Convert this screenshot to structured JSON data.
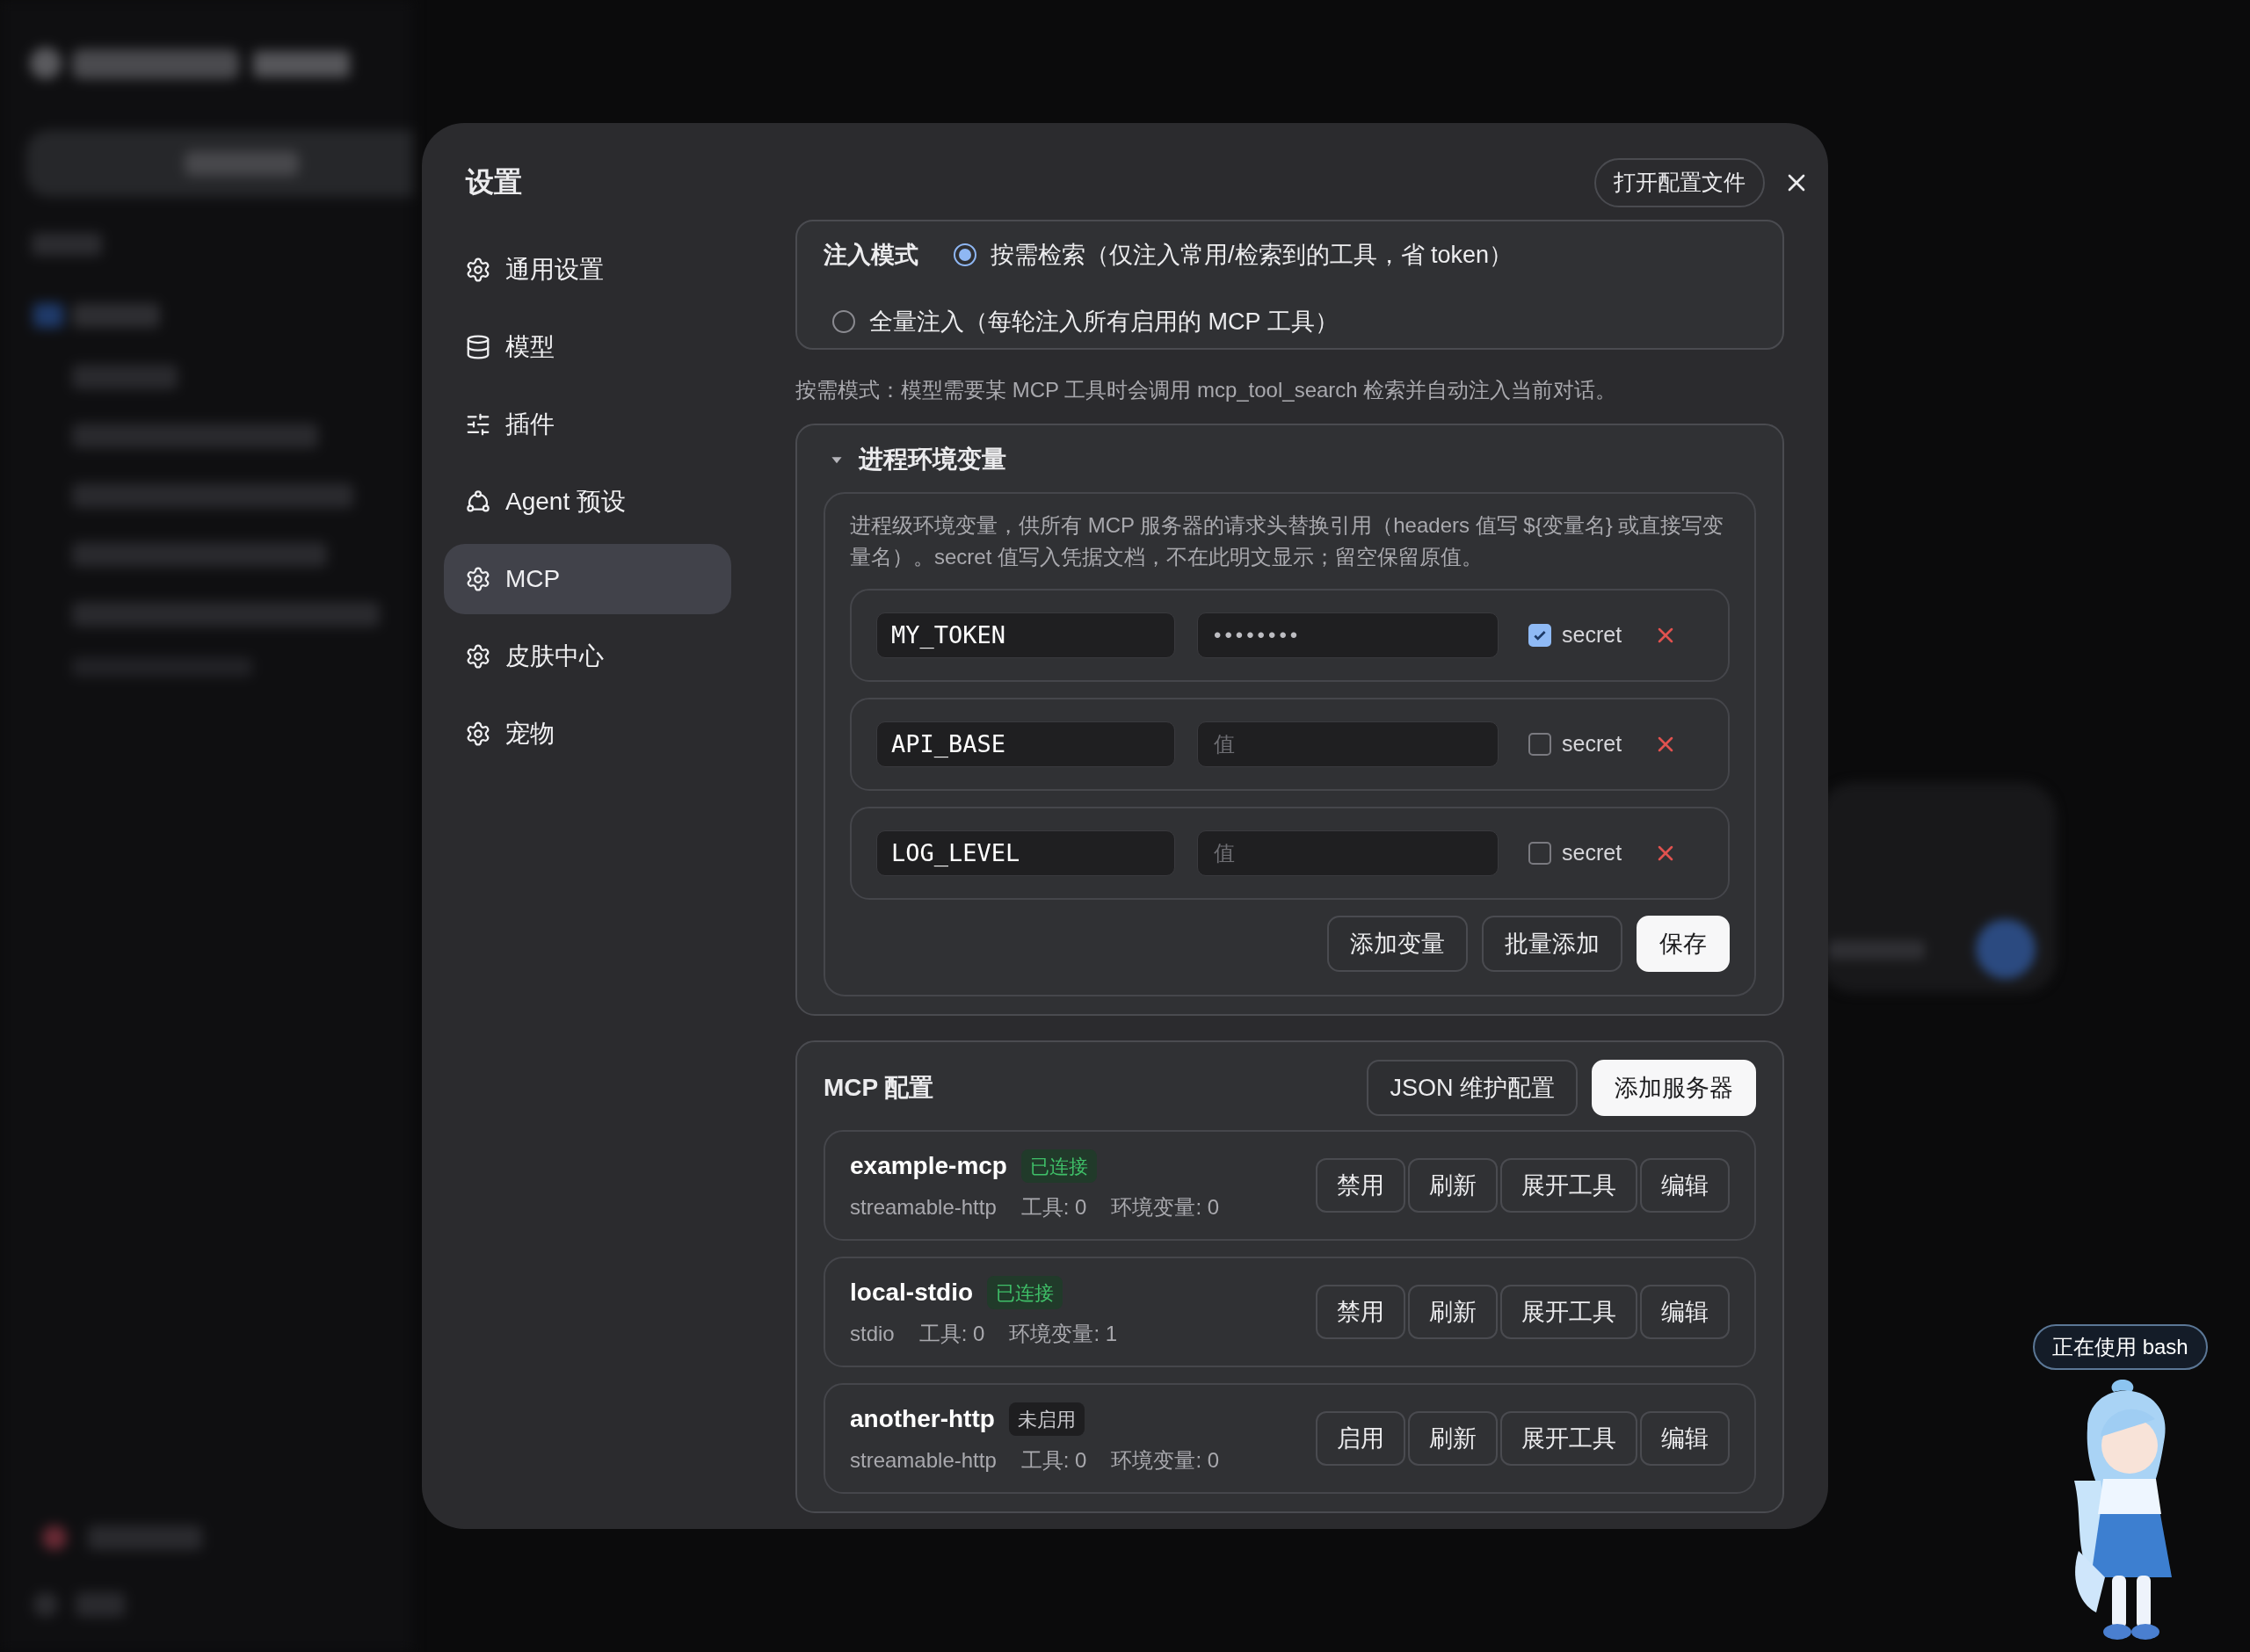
{
  "dialog": {
    "title": "设置",
    "open_config_button": "打开配置文件"
  },
  "nav": [
    {
      "label": "通用设置",
      "kind": "gear",
      "selected": false
    },
    {
      "label": "模型",
      "kind": "database",
      "selected": false
    },
    {
      "label": "插件",
      "kind": "sliders",
      "selected": false
    },
    {
      "label": "Agent 预设",
      "kind": "nodes",
      "selected": false
    },
    {
      "label": "MCP",
      "kind": "gear",
      "selected": true
    },
    {
      "label": "皮肤中心",
      "kind": "gear",
      "selected": false
    },
    {
      "label": "宠物",
      "kind": "gear",
      "selected": false
    }
  ],
  "injection": {
    "label": "注入模式",
    "options": [
      {
        "label": "按需检索（仅注入常用/检索到的工具，省 token）",
        "selected": true
      },
      {
        "label": "全量注入（每轮注入所有启用的 MCP 工具）",
        "selected": false
      }
    ],
    "hint": "按需模式：模型需要某 MCP 工具时会调用 mcp_tool_search 检索并自动注入当前对话。"
  },
  "env": {
    "title": "进程环境变量",
    "expanded": true,
    "description": "进程级环境变量，供所有 MCP 服务器的请求头替换引用（headers 值写 ${变量名} 或直接写变量名）。secret 值写入凭据文档，不在此明文显示；留空保留原值。",
    "vars": [
      {
        "name": "MY_TOKEN",
        "value": "••••••••",
        "secret": true,
        "secret_label": "secret"
      },
      {
        "name": "API_BASE",
        "placeholder": "值",
        "secret": false,
        "secret_label": "secret"
      },
      {
        "name": "LOG_LEVEL",
        "placeholder": "值",
        "secret": false,
        "secret_label": "secret"
      }
    ],
    "buttons": [
      {
        "label": "添加变量",
        "primary": false
      },
      {
        "label": "批量添加",
        "primary": false
      },
      {
        "label": "保存",
        "primary": true
      }
    ]
  },
  "mcp": {
    "title": "MCP 配置",
    "buttons": [
      {
        "label": "JSON 维护配置",
        "primary": false
      },
      {
        "label": "添加服务器",
        "primary": true
      }
    ],
    "servers": [
      {
        "name": "example-mcp",
        "status": "已连接",
        "kind": "connected",
        "transport": "streamable-http",
        "tools": "工具: 0",
        "env": "环境变量: 0",
        "actions": [
          "禁用",
          "刷新",
          "展开工具",
          "编辑"
        ]
      },
      {
        "name": "local-stdio",
        "status": "已连接",
        "kind": "connected",
        "transport": "stdio",
        "tools": "工具: 0",
        "env": "环境变量: 1",
        "actions": [
          "禁用",
          "刷新",
          "展开工具",
          "编辑"
        ]
      },
      {
        "name": "another-http",
        "status": "未启用",
        "kind": "disabled",
        "transport": "streamable-http",
        "tools": "工具: 0",
        "env": "环境变量: 0",
        "actions": [
          "启用",
          "刷新",
          "展开工具",
          "编辑"
        ]
      }
    ]
  },
  "pet": {
    "bubble": "正在使用 bash"
  }
}
